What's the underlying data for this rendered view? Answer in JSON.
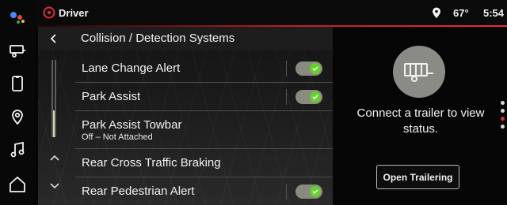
{
  "topbar": {
    "profile_label": "Driver",
    "temperature": "67°",
    "time": "5:54"
  },
  "panel": {
    "title": "Collision / Detection Systems",
    "rows": [
      {
        "label": "Lane Change Alert",
        "toggle_on": true
      },
      {
        "label": "Park Assist",
        "toggle_on": true
      },
      {
        "label": "Park Assist Towbar",
        "sublabel": "Off – Not Attached"
      },
      {
        "label": "Rear Cross Traffic Braking"
      },
      {
        "label": "Rear Pedestrian Alert",
        "toggle_on": true
      }
    ]
  },
  "trailer": {
    "message": "Connect a trailer to view status.",
    "button_label": "Open Trailering"
  },
  "icons": {
    "rail": [
      "google-assistant-icon",
      "trailer-icon",
      "phone-icon",
      "location-pin-icon",
      "music-note-icon",
      "home-icon"
    ],
    "top": [
      "driver-profile-icon",
      "location-icon"
    ]
  },
  "colors": {
    "accent_red": "#e02c35",
    "toggle_green": "#63d22c"
  }
}
